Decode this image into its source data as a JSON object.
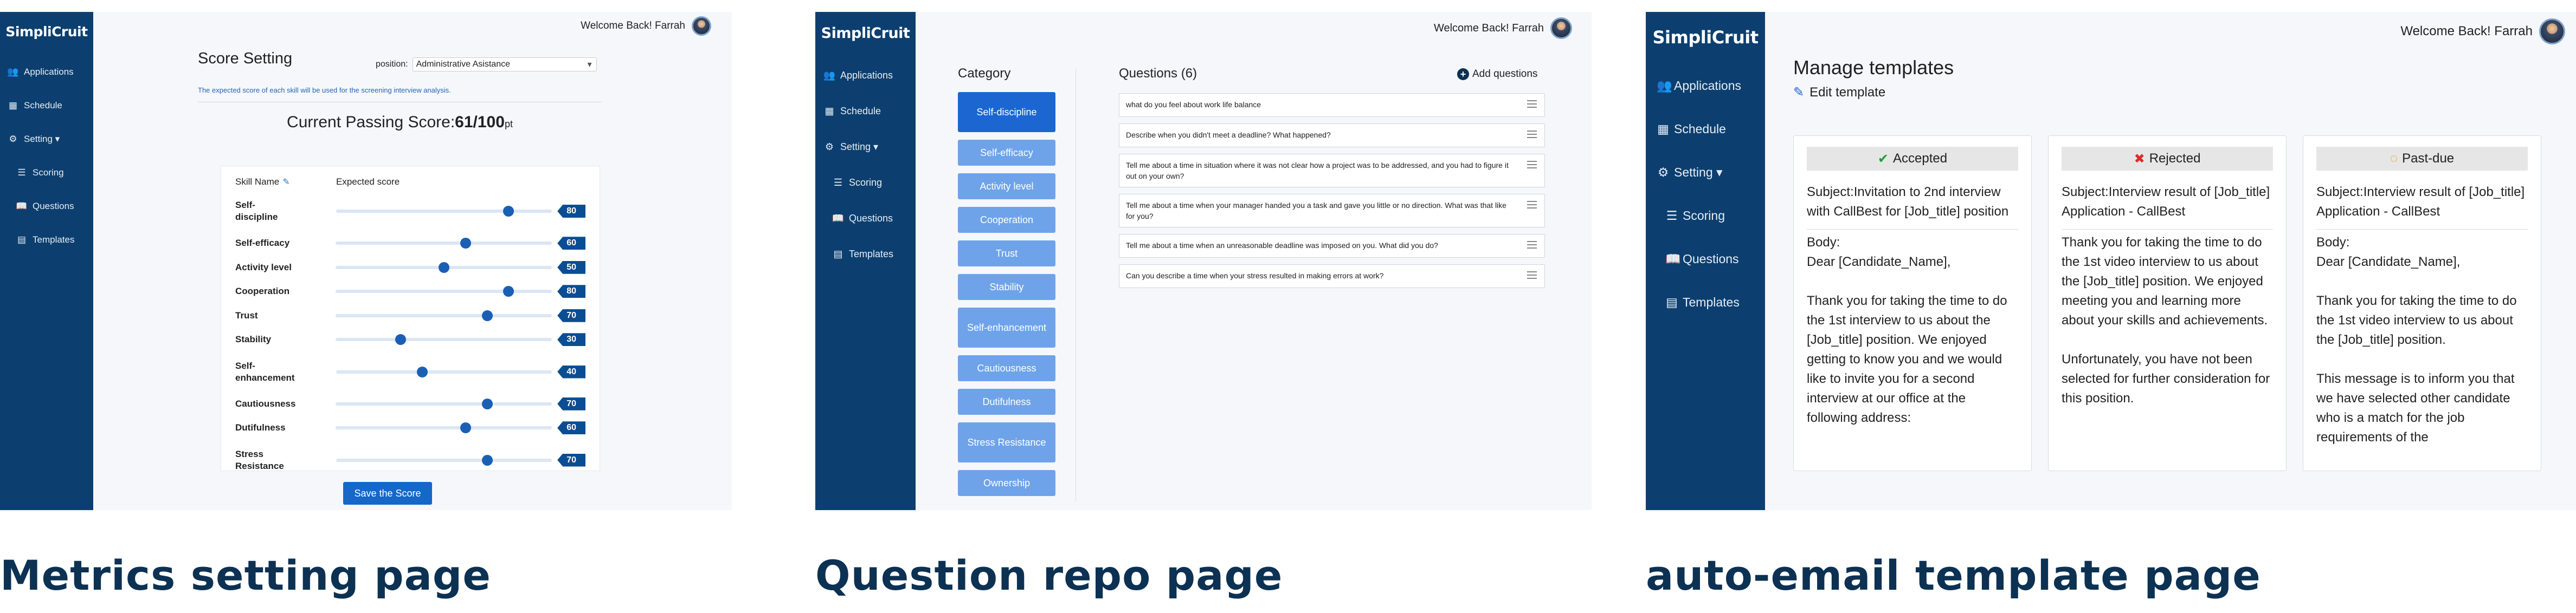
{
  "brand": "SimpliCruit",
  "welcome": "Welcome Back! Farrah",
  "sidebar_items": {
    "applications": "Applications",
    "schedule": "Schedule",
    "setting": "Setting",
    "scoring": "Scoring",
    "questions": "Questions",
    "templates": "Templates"
  },
  "metrics": {
    "title": "Score Setting",
    "position_label": "position:",
    "position_value": "Administrative Asistance",
    "note": "The expected score of each skill will be used for the screening interview analysis.",
    "passing_label": "Current Passing Score:",
    "passing_value": "61/100",
    "passing_unit": "pt",
    "col_skill": "Skill Name",
    "col_expected": "Expected score",
    "skills": [
      {
        "name": "Self-discipline",
        "score": 80
      },
      {
        "name": "Self-efficacy",
        "score": 60
      },
      {
        "name": "Activity level",
        "score": 50
      },
      {
        "name": "Cooperation",
        "score": 80
      },
      {
        "name": "Trust",
        "score": 70
      },
      {
        "name": "Stability",
        "score": 30
      },
      {
        "name": "Self-enhancement",
        "score": 40
      },
      {
        "name": "Cautiousness",
        "score": 70
      },
      {
        "name": "Dutifulness",
        "score": 60
      },
      {
        "name": "Stress Resistance",
        "score": 70
      }
    ],
    "save_label": "Save the Score"
  },
  "questions_page": {
    "category_title": "Category",
    "categories": [
      "Self-discipline",
      "Self-efficacy",
      "Activity level",
      "Cooperation",
      "Trust",
      "Stability",
      "Self-enhancement",
      "Cautiousness",
      "Dutifulness",
      "Stress Resistance",
      "Ownership"
    ],
    "active_category": "Self-discipline",
    "questions_title": "Questions (6)",
    "add_label": "Add questions",
    "questions": [
      "what do you feel about work life balance",
      "Describe when you didn't meet a deadline? What happened?",
      "Tell me about a time in situation where it was not clear how a project was to be addressed, and you had to figure it out on your own?",
      "Tell me about a time when your manager handed you a task and gave you little or no direction. What was that like for you?",
      "Tell me about a time when an unreasonable deadline was imposed on you. What did you do?",
      "Can you describe a time when your stress resulted in making errors at work?"
    ]
  },
  "templates_page": {
    "title": "Manage templates",
    "edit_label": "Edit template",
    "cards": [
      {
        "status": "Accepted",
        "status_icon": "check-icon",
        "status_color": "#1f9d3a",
        "subject": "Subject:Invitation to 2nd interview with CallBest for [Job_title] position",
        "body": "Body:\nDear [Candidate_Name],\n\nThank you for taking the time to do the 1st interview to us about the [Job_title] position. We enjoyed getting to know you and we would like to invite you for a second interview at our office at the following address:"
      },
      {
        "status": "Rejected",
        "status_icon": "cross-icon",
        "status_color": "#d92b2b",
        "subject": "Subject:Interview result of [Job_title] Application - CallBest",
        "body": "Thank you for taking the time to do the 1st video interview to us about the [Job_title] position. We enjoyed meeting you and learning more about your skills and achievements.\n\nUnfortunately, you have not been selected for further consideration for this position."
      },
      {
        "status": "Past-due",
        "status_icon": "clock-icon",
        "status_color": "#e69b00",
        "subject": "Subject:Interview result of [Job_title] Application - CallBest",
        "body": "Body:\nDear [Candidate_Name],\n\nThank you for taking the time to do the 1st video interview to us about the [Job_title] position.\n\nThis message is to inform you that we have selected other candidate who is a match for the job requirements of the"
      }
    ]
  },
  "section_labels": {
    "metrics": "Metrics setting page",
    "questions": "Question repo page",
    "templates": "auto-email template page"
  }
}
